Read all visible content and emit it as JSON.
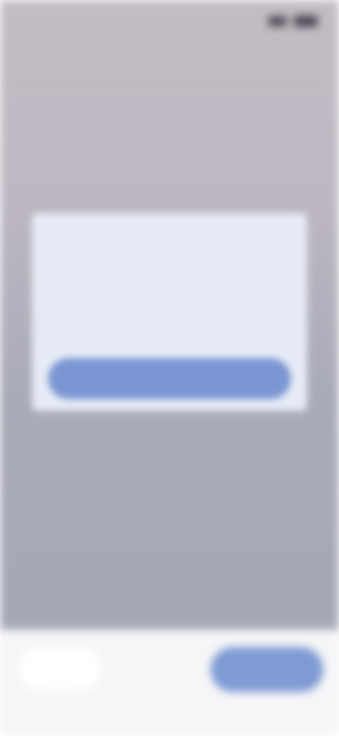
{
  "status_bar": {
    "time": "",
    "icons": [
      "signal-icon",
      "battery-icon"
    ]
  },
  "page": {
    "title": "",
    "section_label": ""
  },
  "chips": [
    "",
    "",
    ""
  ],
  "dialog": {
    "title": "",
    "body": "",
    "button_label": ""
  },
  "bottom_bar": {
    "back_label": "",
    "next_label": ""
  },
  "colors": {
    "dialog_bg": "#e6ebf5",
    "accent": "#7b96d3",
    "dialog_title": "#5b70a8",
    "overlay_top": "#c4bcc4",
    "overlay_bottom": "#a6a8b6",
    "bottom_bar_bg": "#f6f6f8"
  }
}
